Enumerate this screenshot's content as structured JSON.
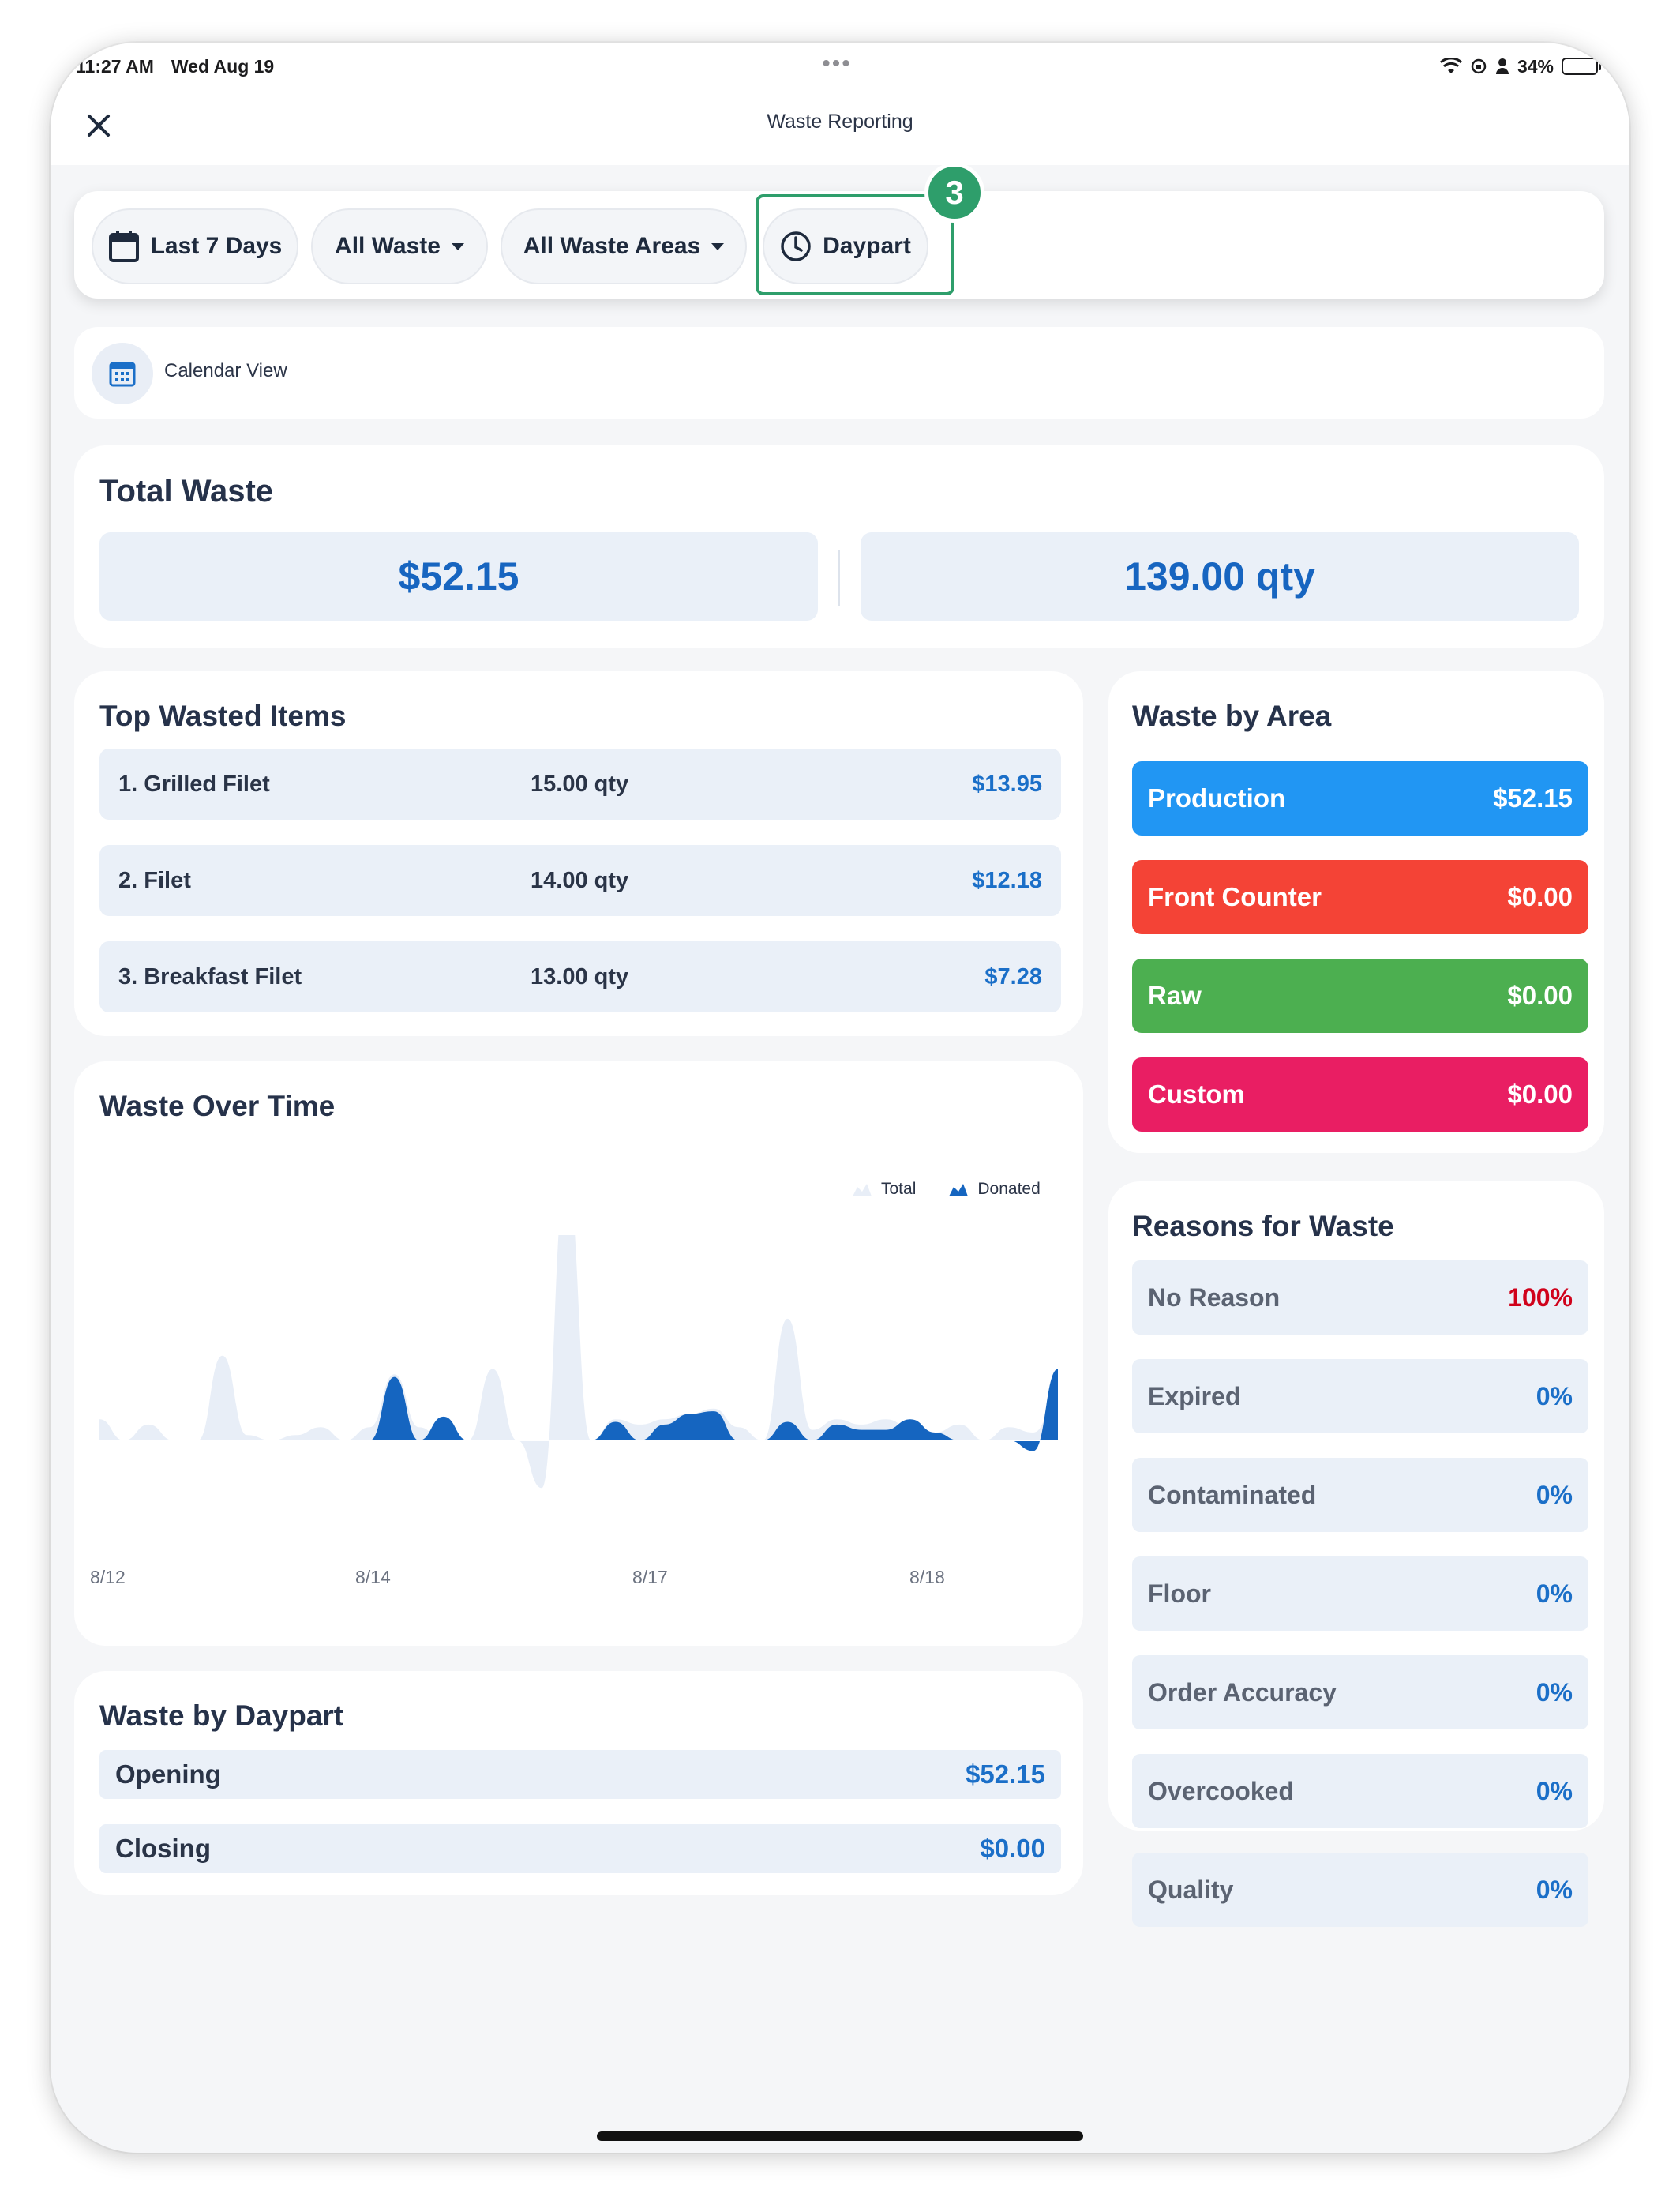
{
  "status_bar": {
    "time": "11:27 AM",
    "date": "Wed Aug 19",
    "battery": "34%"
  },
  "header": {
    "title": "Waste Reporting"
  },
  "filters": {
    "date_range": "Last 7 Days",
    "waste_type": "All Waste",
    "waste_area": "All Waste Areas",
    "daypart": "Daypart",
    "step_badge": "3"
  },
  "calendar_view": {
    "label": "Calendar View"
  },
  "total_waste": {
    "title": "Total Waste",
    "amount": "$52.15",
    "quantity": "139.00 qty"
  },
  "top_wasted_items": {
    "title": "Top Wasted Items",
    "items": [
      {
        "name": "1. Grilled Filet",
        "qty": "15.00 qty",
        "cost": "$13.95"
      },
      {
        "name": "2. Filet",
        "qty": "14.00 qty",
        "cost": "$12.18"
      },
      {
        "name": "3. Breakfast Filet",
        "qty": "13.00 qty",
        "cost": "$7.28"
      }
    ]
  },
  "waste_by_area": {
    "title": "Waste by Area",
    "areas": [
      {
        "name": "Production",
        "value": "$52.15",
        "color": "#2196f3"
      },
      {
        "name": "Front Counter",
        "value": "$0.00",
        "color": "#f44336"
      },
      {
        "name": "Raw",
        "value": "$0.00",
        "color": "#4caf50"
      },
      {
        "name": "Custom",
        "value": "$0.00",
        "color": "#e91e63"
      }
    ]
  },
  "waste_over_time": {
    "title": "Waste Over Time",
    "legend": {
      "total": "Total",
      "donated": "Donated"
    },
    "colors": {
      "total": "#e8eef7",
      "donated": "#1565c0"
    }
  },
  "chart_data": {
    "type": "area",
    "x_ticks": [
      "8/12",
      "8/14",
      "8/17",
      "8/18"
    ],
    "series": [
      {
        "name": "Total",
        "values": [
          0.08,
          0.0,
          0.06,
          0.0,
          0.0,
          0.32,
          0.02,
          0.0,
          0.02,
          0.05,
          0.0,
          0.05,
          0.25,
          0.05,
          0.0,
          0.0,
          0.27,
          0.0,
          -0.18,
          1.0,
          0.0,
          0.08,
          0.06,
          0.08,
          0.1,
          0.12,
          0.05,
          0.0,
          0.46,
          0.04,
          0.08,
          0.06,
          0.08,
          0.05,
          0.03,
          0.06,
          0.0,
          0.05,
          0.03,
          0.16
        ]
      },
      {
        "name": "Donated",
        "values": [
          0.0,
          0.0,
          0.0,
          0.0,
          0.0,
          0.0,
          0.0,
          0.0,
          0.0,
          0.0,
          0.0,
          0.0,
          0.24,
          0.0,
          0.09,
          0.0,
          0.0,
          0.0,
          0.0,
          0.0,
          0.0,
          0.07,
          0.0,
          0.06,
          0.1,
          0.11,
          0.0,
          0.0,
          0.07,
          0.0,
          0.06,
          0.04,
          0.04,
          0.08,
          0.03,
          0.0,
          0.0,
          0.0,
          -0.04,
          0.27
        ]
      }
    ]
  },
  "waste_by_daypart": {
    "title": "Waste by Daypart",
    "rows": [
      {
        "name": "Opening",
        "value": "$52.15"
      },
      {
        "name": "Closing",
        "value": "$0.00"
      }
    ]
  },
  "reasons_for_waste": {
    "title": "Reasons for Waste",
    "reasons": [
      {
        "name": "No Reason",
        "value": "100%",
        "color": "#d0021b"
      },
      {
        "name": "Expired",
        "value": "0%",
        "color": "#1b6fc8"
      },
      {
        "name": "Contaminated",
        "value": "0%",
        "color": "#1b6fc8"
      },
      {
        "name": "Floor",
        "value": "0%",
        "color": "#1b6fc8"
      },
      {
        "name": "Order Accuracy",
        "value": "0%",
        "color": "#1b6fc8"
      },
      {
        "name": "Overcooked",
        "value": "0%",
        "color": "#1b6fc8"
      },
      {
        "name": "Quality",
        "value": "0%",
        "color": "#1b6fc8"
      }
    ]
  }
}
